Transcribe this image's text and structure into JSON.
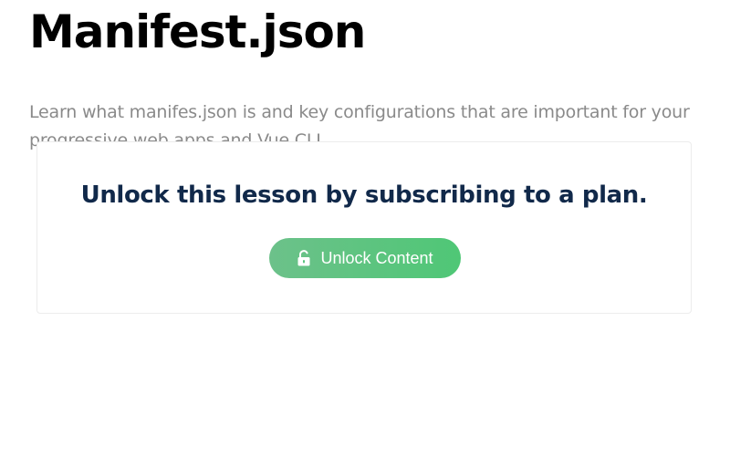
{
  "lesson": {
    "title": "Manifest.json",
    "description": "Learn what manifes.json is and key configurations that are important for your progressive web apps and Vue CLI."
  },
  "paywall": {
    "heading": "Unlock this lesson by subscribing to a plan.",
    "button_label": "Unlock Content",
    "button_icon": "unlock-icon"
  },
  "colors": {
    "heading": "#11294a",
    "button_gradient_start": "#6cc18a",
    "button_gradient_end": "#4fc776",
    "description_text": "#8a8a8a"
  }
}
